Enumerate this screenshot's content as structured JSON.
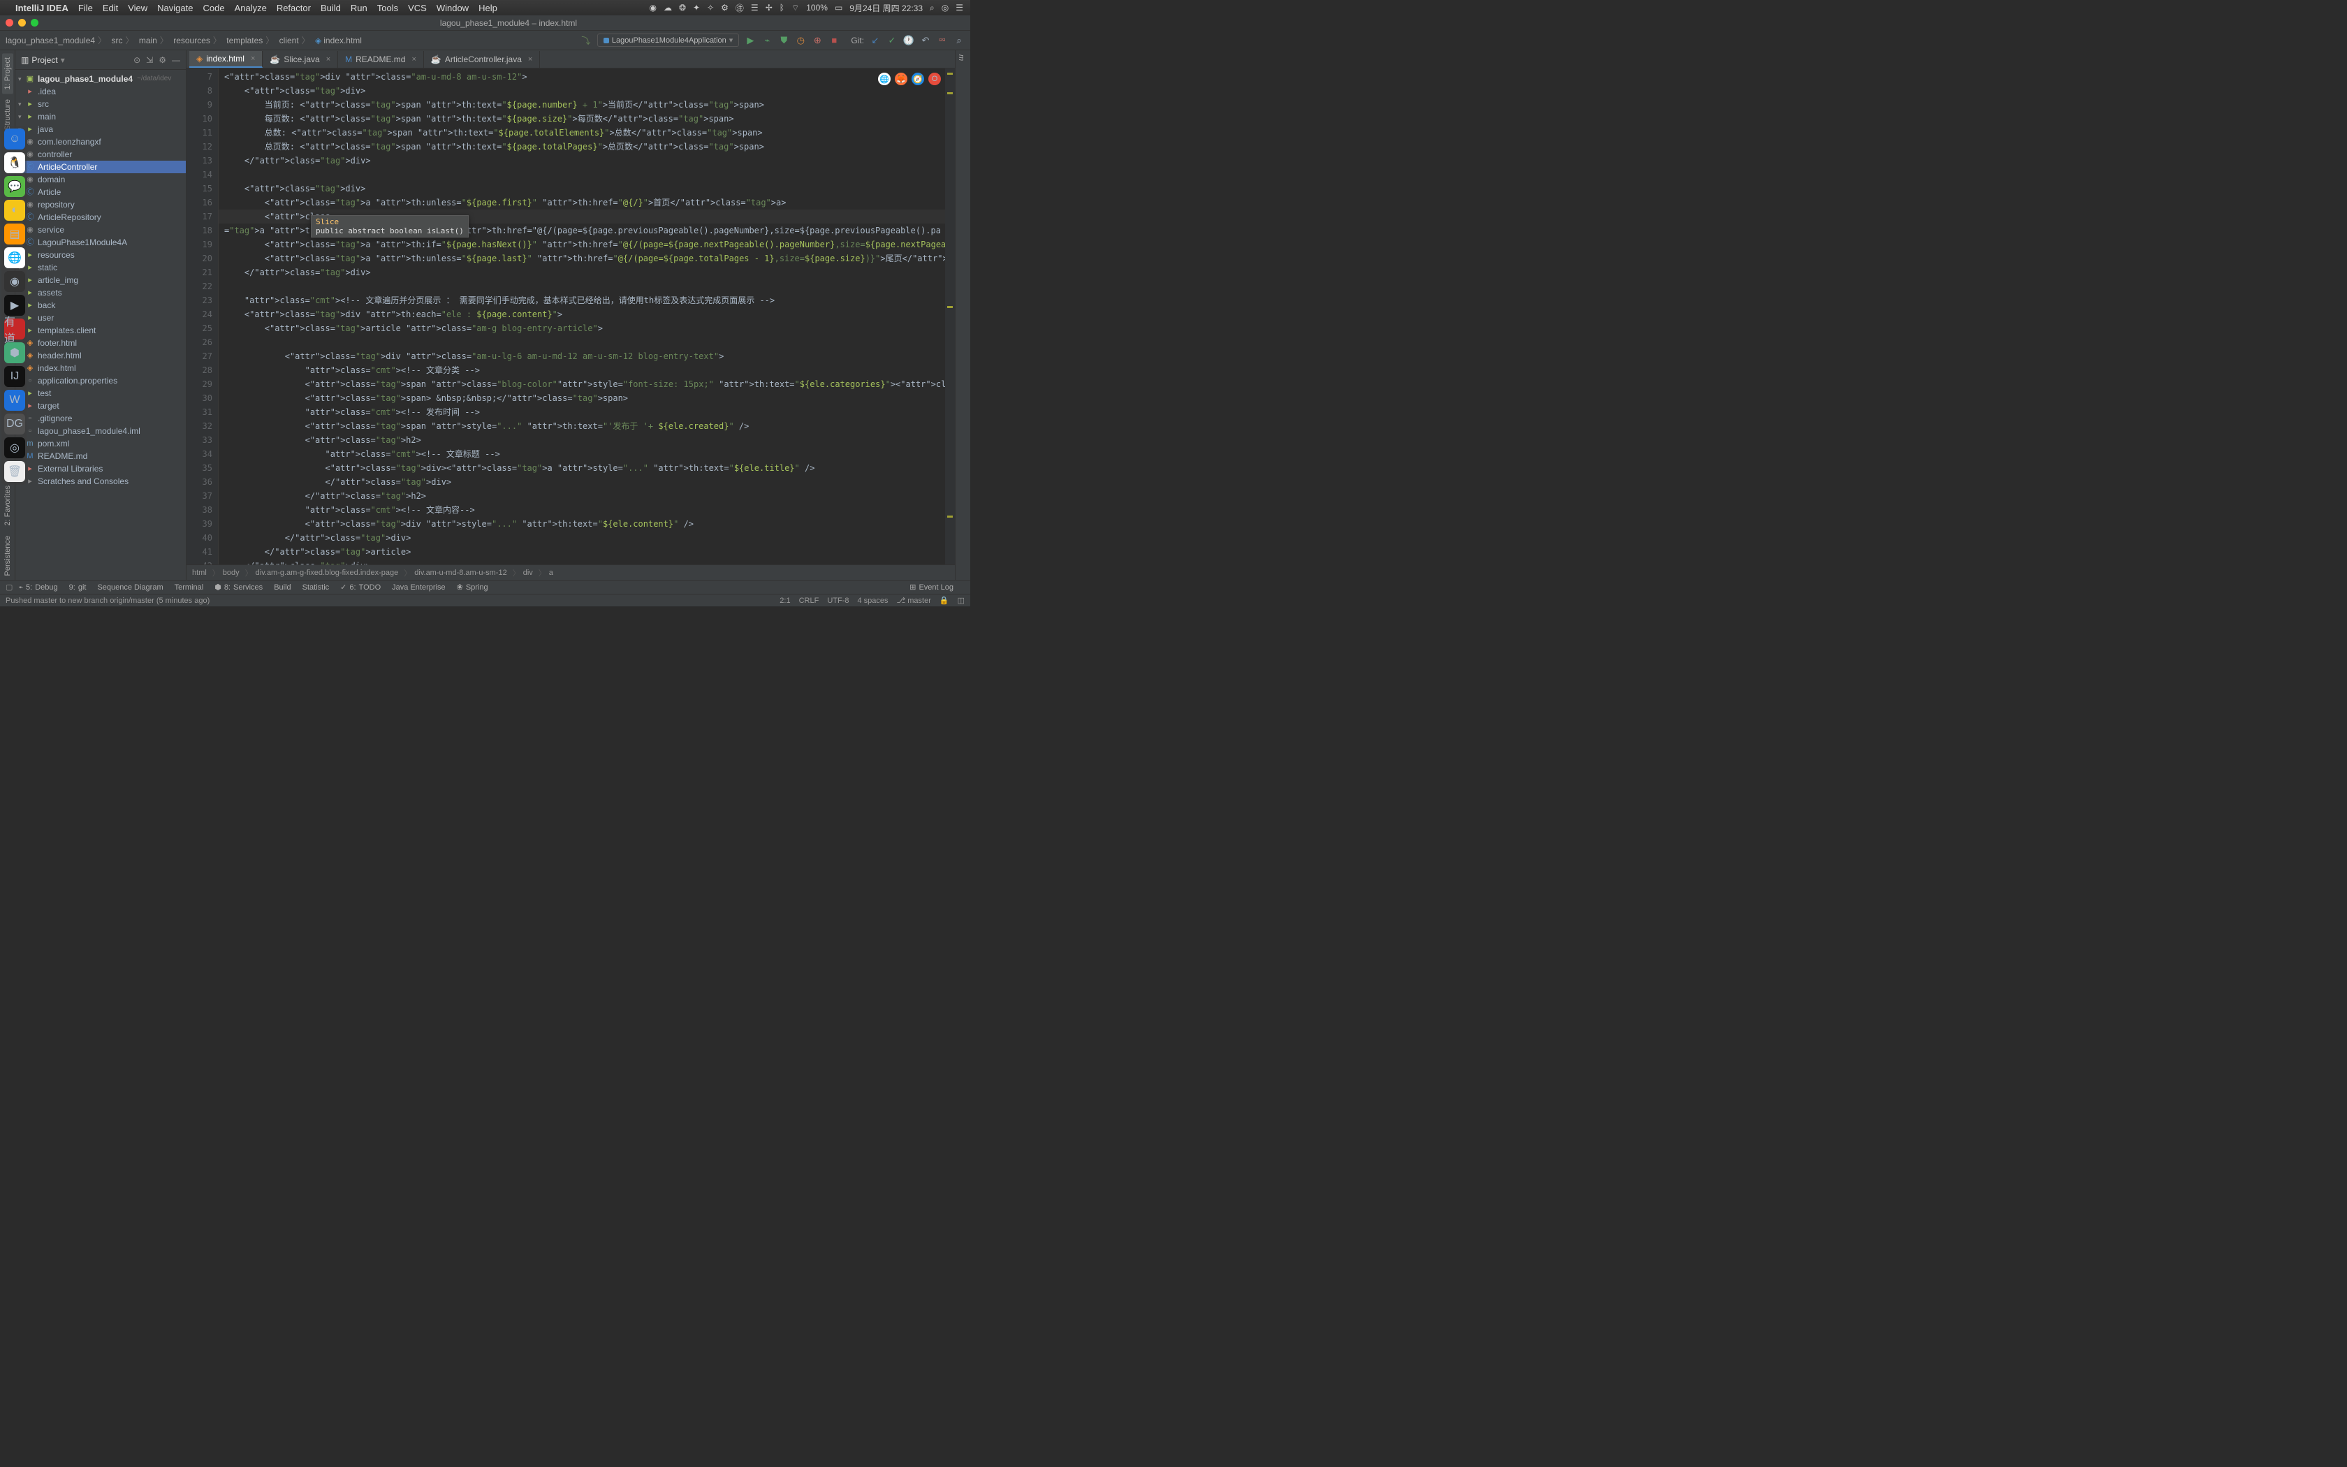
{
  "menubar": {
    "app": "IntelliJ IDEA",
    "items": [
      "File",
      "Edit",
      "View",
      "Navigate",
      "Code",
      "Analyze",
      "Refactor",
      "Build",
      "Run",
      "Tools",
      "VCS",
      "Window",
      "Help"
    ],
    "right": {
      "battery": "100%",
      "ble": "",
      "date": "9月24日 周四 22:33"
    }
  },
  "window": {
    "title": "lagou_phase1_module4 – index.html"
  },
  "breadcrumbs": [
    "lagou_phase1_module4",
    "src",
    "main",
    "resources",
    "templates",
    "client",
    "index.html"
  ],
  "runconfig": "LagouPhase1Module4Application",
  "vcs_label": "Git:",
  "project": {
    "title": "Project",
    "root": "lagou_phase1_module4",
    "rootPath": "~/data/idev",
    "nodes": [
      {
        "depth": 1,
        "icon": "dir",
        "label": ".idea",
        "color": "#d5756c"
      },
      {
        "depth": 1,
        "icon": "dir",
        "label": "src",
        "arrow": "▾"
      },
      {
        "depth": 2,
        "icon": "dir",
        "label": "main",
        "arrow": "▾"
      },
      {
        "depth": 3,
        "icon": "dir",
        "label": "java",
        "arrow": "▾"
      },
      {
        "depth": 4,
        "icon": "pkg",
        "label": "com.leonzhangxf",
        "arrow": "▾"
      },
      {
        "depth": 5,
        "icon": "pkg",
        "label": "controller",
        "arrow": "▾"
      },
      {
        "depth": 6,
        "icon": "cls",
        "label": "ArticleController",
        "hl": true
      },
      {
        "depth": 5,
        "icon": "pkg",
        "label": "domain",
        "arrow": "▾"
      },
      {
        "depth": 6,
        "icon": "cls",
        "label": "Article"
      },
      {
        "depth": 5,
        "icon": "pkg",
        "label": "repository",
        "arrow": "▾"
      },
      {
        "depth": 6,
        "icon": "cls",
        "label": "ArticleRepository"
      },
      {
        "depth": 5,
        "icon": "pkg",
        "label": "service",
        "arrow": "▾"
      },
      {
        "depth": 6,
        "icon": "cls",
        "label": "LagouPhase1Module4A"
      },
      {
        "depth": 3,
        "icon": "dir",
        "label": "resources",
        "arrow": "▾"
      },
      {
        "depth": 4,
        "icon": "dir",
        "label": "static",
        "arrow": "▾"
      },
      {
        "depth": 5,
        "icon": "dir",
        "label": "article_img"
      },
      {
        "depth": 5,
        "icon": "dir",
        "label": "assets"
      },
      {
        "depth": 5,
        "icon": "dir",
        "label": "back"
      },
      {
        "depth": 5,
        "icon": "dir",
        "label": "user"
      },
      {
        "depth": 4,
        "icon": "dir",
        "label": "templates.client",
        "arrow": "▾"
      },
      {
        "depth": 5,
        "icon": "html",
        "label": "footer.html"
      },
      {
        "depth": 5,
        "icon": "html",
        "label": "header.html"
      },
      {
        "depth": 5,
        "icon": "html",
        "label": "index.html"
      },
      {
        "depth": 4,
        "icon": "file",
        "label": "application.properties"
      },
      {
        "depth": 2,
        "icon": "dir",
        "label": "test"
      },
      {
        "depth": 1,
        "icon": "dir",
        "label": "target",
        "color": "#d5756c"
      },
      {
        "depth": 1,
        "icon": "file",
        "label": ".gitignore"
      },
      {
        "depth": 1,
        "icon": "file",
        "label": "lagou_phase1_module4.iml"
      },
      {
        "depth": 1,
        "icon": "m",
        "label": "pom.xml"
      },
      {
        "depth": 1,
        "icon": "md",
        "label": "README.md"
      },
      {
        "depth": 0,
        "icon": "lib",
        "label": "External Libraries"
      },
      {
        "depth": 0,
        "icon": "scr",
        "label": "Scratches and Consoles"
      }
    ]
  },
  "tabs": [
    {
      "label": "index.html",
      "icon": "html",
      "active": true
    },
    {
      "label": "Slice.java",
      "icon": "java"
    },
    {
      "label": "README.md",
      "icon": "md"
    },
    {
      "label": "ArticleController.java",
      "icon": "java"
    }
  ],
  "tooltip": {
    "name": "Slice",
    "sig": "public abstract boolean isLast()"
  },
  "code": {
    "startLine": 7,
    "lines": [
      "<div class=\"am-u-md-8 am-u-sm-12\">",
      "    <div>",
      "        当前页: <span th:text=\"${page.number} + 1\">当前页</span>",
      "        每页数: <span th:text=\"${page.size}\">每页数</span>",
      "        总数: <span th:text=\"${page.totalElements}\">总数</span>",
      "        总页数: <span th:text=\"${page.totalPages}\">总页数</span>",
      "    </div>",
      "",
      "    <div>",
      "        <a th:unless=\"${page.first}\" th:href=\"@{/}\">首页</a>",
      "        <a th:if=\"${page.hasPrevious()}\" th:href=\"@{/(page=${page.previousPageable().pageNumber},size=${page.previousPageable().pa",
      "        <a th:if=\"${page.hasNext()}\" th:href=\"@{/(page=${page.nextPageable().pageNumber},size=${page.nextPageable().pageSize})}\">下",
      "        <a th:unless=\"${page.last}\" th:href=\"@{/(page=${page.totalPages - 1},size=${page.size})}\">尾页</a>",
      "    </div>",
      "",
      "    <!-- 文章遍历并分页展示 ： 需要同学们手动完成，基本样式已经给出，请使用th标签及表达式完成页面展示 -->",
      "    <div th:each=\"ele : ${page.content}\">",
      "        <article class=\"am-g blog-entry-article\">",
      "",
      "            <div class=\"am-u-lg-6 am-u-md-12 am-u-sm-12 blog-entry-text\">",
      "                <!-- 文章分类 -->",
      "                <span class=\"blog-color\"style=\"font-size: 15px;\" th:text=\"${ele.categories}\"><a>默认分类</a></span>",
      "                <span> &nbsp;&nbsp;</span>",
      "                <!-- 发布时间 -->",
      "                <span style=\"...\" th:text=\"'发布于 '+ ${ele.created}\" />",
      "                <h2>",
      "                    <!-- 文章标题 -->",
      "                    <div><a style=\"...\" th:text=\"${ele.title}\" />",
      "                    </div>",
      "                </h2>",
      "                <!-- 文章内容-->",
      "                <div style=\"...\" th:text=\"${ele.content}\" />",
      "            </div>",
      "        </article>",
      "    </div>",
      ""
    ]
  },
  "code_breadcrumb": [
    "html",
    "body",
    "div.am-g.am-g-fixed.blog-fixed.index-page",
    "div.am-u-md-8.am-u-sm-12",
    "div",
    "a"
  ],
  "bottom_tools": [
    "Debug",
    "git",
    "Sequence Diagram",
    "Terminal",
    "Services",
    "Build",
    "Statistic",
    "TODO",
    "Java Enterprise",
    "Spring"
  ],
  "bottom_tools_prefix": [
    "5:",
    "9:",
    "",
    "",
    "8:",
    "",
    "",
    "6:",
    "",
    ""
  ],
  "event_log": "Event Log",
  "status": {
    "msg": "Pushed master to new branch origin/master (5 minutes ago)",
    "pos": "2:1",
    "lf": "CRLF",
    "enc": "UTF-8",
    "indent": "4 spaces",
    "branch": "master"
  },
  "left_tabs": [
    "1: Project",
    "7: Structure",
    "2: Favorites",
    "Persistence"
  ]
}
